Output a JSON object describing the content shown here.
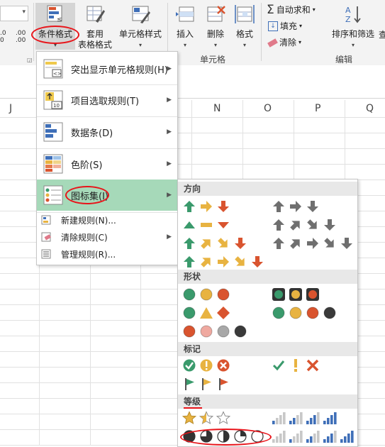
{
  "ribbon": {
    "conditional_formatting": "条件格式",
    "format_as_table_l1": "套用",
    "format_as_table_l2": "表格格式",
    "cell_styles": "单元格样式",
    "insert": "插入",
    "delete": "删除",
    "format": "格式",
    "group_cells": "单元格",
    "autosum": "自动求和",
    "fill": "填充",
    "clear": "清除",
    "sort_filter": "排序和筛选",
    "find": "查",
    "group_editing": "编辑",
    "num_dec1": ".0",
    "num_dec2": ".00",
    "num_dec3": ".00",
    "num_dec4": "0"
  },
  "columns": [
    "J",
    "N",
    "O",
    "P",
    "Q"
  ],
  "menu": {
    "items": [
      {
        "label": "突出显示单元格规则(H)"
      },
      {
        "label": "项目选取规则(T)"
      },
      {
        "label": "数据条(D)"
      },
      {
        "label": "色阶(S)"
      },
      {
        "label": "图标集(I)"
      }
    ],
    "small_items": [
      {
        "label": "新建规则(N)..."
      },
      {
        "label": "清除规则(C)"
      },
      {
        "label": "管理规则(R)..."
      }
    ],
    "top_rules_icon_text": "10",
    "highlight_icon_text": "<>"
  },
  "icon_sets": {
    "sections": [
      "方向",
      "形状",
      "标记",
      "等级"
    ]
  },
  "colors": {
    "green": "#3a9a6c",
    "yellow": "#e8b341",
    "red": "#d9542f",
    "gray": "#6f6f6f",
    "menu_selected": "#a6d9b9",
    "annotation_red": "#e8141a"
  }
}
